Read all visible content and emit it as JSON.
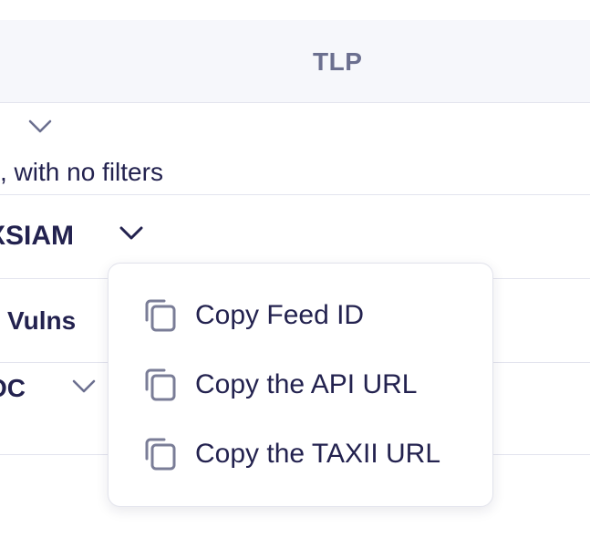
{
  "header": {
    "tlp_label": "TLP"
  },
  "rows": [
    {
      "subtext": ", with no filters",
      "icon": "chevron-down-icon"
    },
    {
      "name": "XSIAM",
      "icon": "chevron-down-icon"
    },
    {
      "name": "Vulns"
    },
    {
      "name": "OC",
      "icon": "chevron-down-icon"
    }
  ],
  "context_menu": {
    "items": [
      {
        "label": "Copy Feed ID",
        "icon": "copy-icon"
      },
      {
        "label": "Copy the API URL",
        "icon": "copy-icon"
      },
      {
        "label": "Copy the TAXII URL",
        "icon": "copy-icon"
      }
    ]
  },
  "colors": {
    "text": "#23224f",
    "muted": "#6b6f8f",
    "header_bg": "#f6f7fb",
    "border": "#e3e4ee"
  }
}
